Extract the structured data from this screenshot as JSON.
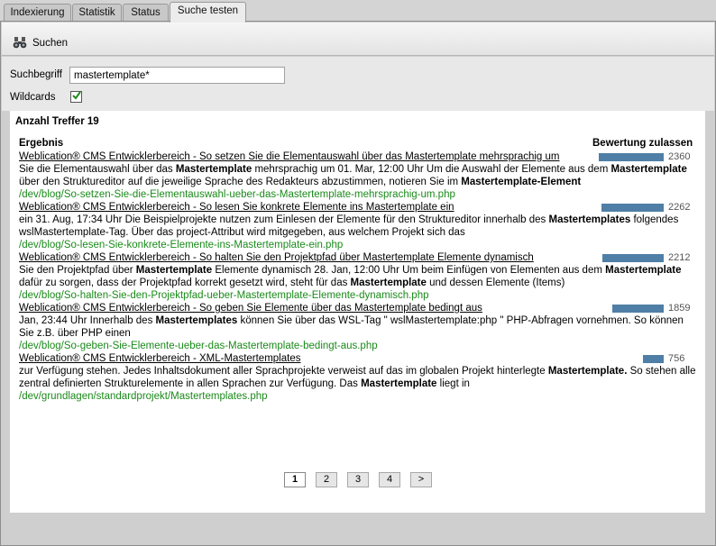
{
  "tabs": [
    {
      "label": "Indexierung"
    },
    {
      "label": "Statistik"
    },
    {
      "label": "Status"
    },
    {
      "label": "Suche testen"
    }
  ],
  "toolbar": {
    "search_label": "Suchen"
  },
  "form": {
    "term_label": "Suchbegriff",
    "term_value": "mastertemplate*",
    "wildcards_label": "Wildcards",
    "wildcards_checked": true
  },
  "results": {
    "count_label": "Anzahl Treffer 19",
    "col_result": "Ergebnis",
    "col_rating": "Bewertung zulassen",
    "items": [
      {
        "title": "Weblication® CMS Entwicklerbereich - So setzen Sie die Elementauswahl über das Mastertemplate mehrsprachig um",
        "snippet_parts": [
          "Sie die Elementauswahl über das ",
          "Mastertemplate",
          " mehrsprachig um 01. Mar, 12:00 Uhr Um die Auswahl der Elemente aus dem ",
          "Mastertemplate",
          " über den Strukturedit­or auf die jeweilige Sprache des Redakteurs abzustimmen, notieren Sie im ",
          "Mastertemplate-Element"
        ],
        "url": "/dev/blog/So-setzen-Sie-die-Elementauswahl-ueber-das-Mastertemplate-mehrsprachig-um.php",
        "score": "2360",
        "score_fraction": 1.0
      },
      {
        "title": "Weblication® CMS Entwicklerbereich - So lesen Sie konkrete Elemente ins Mastertemplate ein",
        "snippet_parts": [
          "ein 31. Aug, 17:34 Uhr Die Beispielprojekte nutzen zum Einlesen der Elemente für den Struktureditor innerhalb des ",
          "Mastertemplates",
          " folgendes wslMastertemplate-Tag. Über das project-Attribut wird mitgegeben, aus welchem Projekt sich das",
          "",
          ""
        ],
        "url": "/dev/blog/So-lesen-Sie-konkrete-Elemente-ins-Mastertemplate-ein.php",
        "score": "2262",
        "score_fraction": 0.96
      },
      {
        "title": "Weblication® CMS Entwicklerbereich - So halten Sie den Projektpfad über Mastertemplate Elemente dynamisch",
        "snippet_parts": [
          "Sie den Projektpfad über ",
          "Mastertemplate",
          " Elemente dynamisch 28. Jan, 12:00 Uhr Um beim Einfügen von Elementen aus dem ",
          "Mastertemplate",
          " dafür zu sorgen, dass der Projektpfad korrekt gesetzt wird, steht für das ",
          "Mastertemplate",
          " und dessen Elemente (Items)"
        ],
        "url": "/dev/blog/So-halten-Sie-den-Projektpfad-ueber-Mastertemplate-Elemente-dynamisch.php",
        "score": "2212",
        "score_fraction": 0.94
      },
      {
        "title": "Weblication® CMS Entwicklerbereich - So geben Sie Elemente über das Mastertemplate bedingt aus",
        "snippet_parts": [
          "Jan, 23:44 Uhr Innerhalb des ",
          "Mastertemplates",
          " können Sie über das WSL-Tag \" wslMastertemplate:php \" PHP-Abfragen vornehmen. So können Sie z.B. über PHP einen"
        ],
        "url": "/dev/blog/So-geben-Sie-Elemente-ueber-das-Mastertemplate-bedingt-aus.php",
        "score": "1859",
        "score_fraction": 0.79
      },
      {
        "title": "Weblication® CMS Entwicklerbereich - XML-Mastertemplates",
        "snippet_parts": [
          "zur Verfügung stehen. Jedes Inhaltsdokument aller Sprachprojekte verweist auf das im globalen Projekt hinterlegte ",
          "Mastertemplate.",
          " So stehen alle zentral definierten Strukturelemente in allen Sprachen zur Verfügung. Das ",
          "Mastertemplate",
          " liegt in"
        ],
        "url": "/dev/grundlagen/standardprojekt/Mastertemplates.php",
        "score": "756",
        "score_fraction": 0.32
      }
    ]
  },
  "pager": {
    "pages": [
      "1",
      "2",
      "3",
      "4"
    ],
    "current": "1",
    "next": ">"
  },
  "colors": {
    "accent_bar": "#4f7fa6",
    "url_green": "#1a8a1a"
  }
}
